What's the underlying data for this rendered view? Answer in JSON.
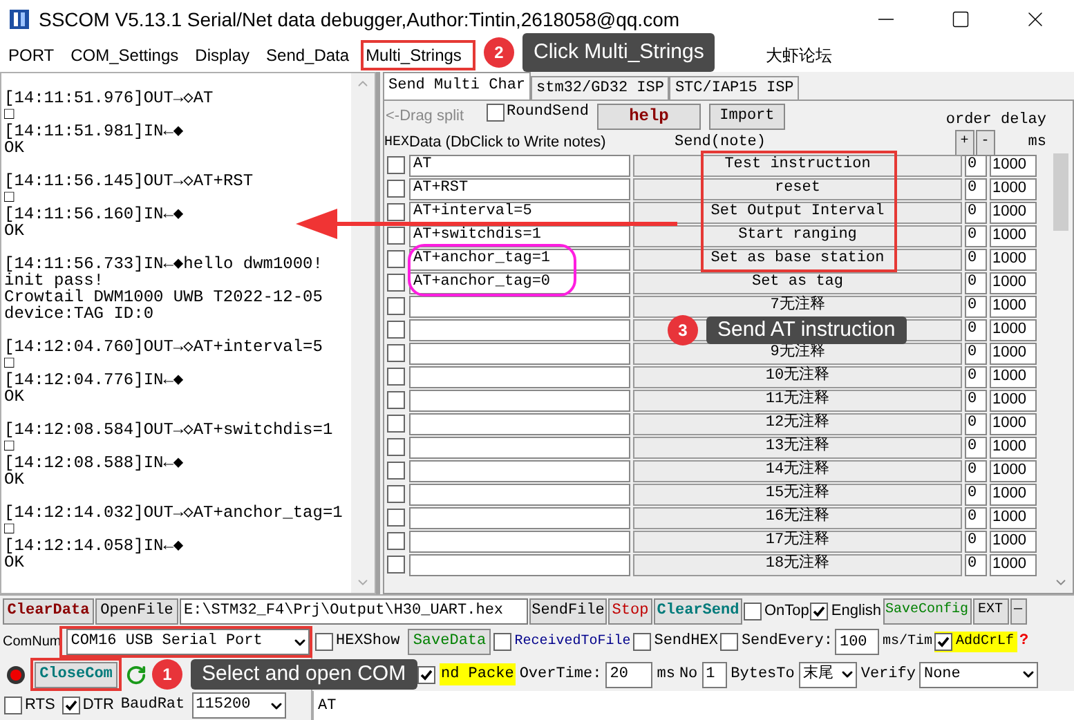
{
  "window": {
    "title": "SSCOM V5.13.1 Serial/Net data debugger,Author:Tintin,2618058@qq.com"
  },
  "menu": [
    {
      "label": "PORT"
    },
    {
      "label": "COM_Settings"
    },
    {
      "label": "Display"
    },
    {
      "label": "Send_Data"
    },
    {
      "label": "Multi_Strings"
    },
    {
      "label": "大虾论坛"
    }
  ],
  "log": [
    {
      "lines": [
        "[14:11:51.976]OUT→◇AT",
        "□",
        "[14:11:51.981]IN←◆",
        "OK"
      ]
    },
    {
      "lines": [
        "[14:11:56.145]OUT→◇AT+RST",
        "□",
        "[14:11:56.160]IN←◆",
        "OK"
      ]
    },
    {
      "lines": [
        "[14:11:56.733]IN←◆hello dwm1000!",
        "init pass!",
        "Crowtail DWM1000 UWB T2022-12-05",
        "device:TAG ID:0"
      ]
    },
    {
      "lines": [
        "[14:12:04.760]OUT→◇AT+interval=5",
        "□",
        "[14:12:04.776]IN←◆",
        "OK"
      ]
    },
    {
      "lines": [
        "[14:12:08.584]OUT→◇AT+switchdis=1",
        "□",
        "[14:12:08.588]IN←◆",
        "OK"
      ]
    },
    {
      "lines": [
        "[14:12:14.032]OUT→◇AT+anchor_tag=1",
        "□",
        "[14:12:14.058]IN←◆",
        "OK"
      ]
    }
  ],
  "tabs": [
    {
      "label": "Send Multi Char",
      "selected": true
    },
    {
      "label": "stm32/GD32 ISP",
      "selected": false
    },
    {
      "label": "STC/IAP15 ISP",
      "selected": false
    }
  ],
  "toolbar": {
    "drag_split": "<-Drag split",
    "round_send": {
      "label": "RoundSend",
      "checked": false
    },
    "help": "help",
    "import": "Import",
    "order_delay": "order delay"
  },
  "table": {
    "hex": "HEX",
    "data": "Data (DbClick to Write notes)",
    "send": "Send(note)",
    "plus": "+",
    "minus": "-",
    "ms": "ms",
    "rows": [
      {
        "hex": false,
        "data": "AT",
        "note": "Test instruction",
        "order": "0",
        "delay": "1000"
      },
      {
        "hex": false,
        "data": "AT+RST",
        "note": "reset",
        "order": "0",
        "delay": "1000"
      },
      {
        "hex": false,
        "data": "AT+interval=5",
        "note": "Set Output Interval",
        "order": "0",
        "delay": "1000"
      },
      {
        "hex": false,
        "data": "AT+switchdis=1",
        "note": "Start ranging",
        "order": "0",
        "delay": "1000"
      },
      {
        "hex": false,
        "data": "AT+anchor_tag=1",
        "note": "Set as base station",
        "order": "0",
        "delay": "1000"
      },
      {
        "hex": false,
        "data": "AT+anchor_tag=0",
        "note": "Set as tag",
        "order": "0",
        "delay": "1000"
      },
      {
        "hex": false,
        "note": "7无注释",
        "order": "0",
        "delay": "1000"
      },
      {
        "hex": false,
        "order": "0",
        "delay": "1000"
      },
      {
        "hex": false,
        "note": "9无注释",
        "order": "0",
        "delay": "1000"
      },
      {
        "hex": false,
        "note": "10无注释",
        "order": "0",
        "delay": "1000"
      },
      {
        "hex": false,
        "note": "11无注释",
        "order": "0",
        "delay": "1000"
      },
      {
        "hex": false,
        "note": "12无注释",
        "order": "0",
        "delay": "1000"
      },
      {
        "hex": false,
        "note": "13无注释",
        "order": "0",
        "delay": "1000"
      },
      {
        "hex": false,
        "note": "14无注释",
        "order": "0",
        "delay": "1000"
      },
      {
        "hex": false,
        "note": "15无注释",
        "order": "0",
        "delay": "1000"
      },
      {
        "hex": false,
        "note": "16无注释",
        "order": "0",
        "delay": "1000"
      },
      {
        "hex": false,
        "note": "17无注释",
        "order": "0",
        "delay": "1000"
      },
      {
        "hex": false,
        "note": "18无注释",
        "order": "0",
        "delay": "1000"
      }
    ]
  },
  "bottom": {
    "clear_data": "ClearData",
    "open_file": "OpenFile",
    "file_path": "E:\\STM32_F4\\Prj\\Output\\H30_UART.hex",
    "send_file": "SendFile",
    "stop": "Stop",
    "clear_send": "ClearSend",
    "on_top": {
      "label": "OnTop",
      "checked": false
    },
    "english": {
      "label": "English",
      "checked": true
    },
    "save_config": "SaveConfig",
    "ext": "EXT",
    "collapse": "—",
    "com_num_label": "ComNum",
    "com_port": "COM16 USB Serial Port",
    "hex_show": {
      "label": "HEXShow",
      "checked": false
    },
    "save_data": "SaveData",
    "received_to_file": {
      "label": "ReceivedToFile",
      "checked": false
    },
    "send_hex": {
      "label": "SendHEX",
      "checked": false
    },
    "send_every": {
      "label": "SendEvery:",
      "checked": false
    },
    "send_every_value": "100",
    "ms_tim": "ms/Tim",
    "add_crlf": {
      "label": "AddCrLf",
      "checked": true
    },
    "help_mark": "?",
    "close_com": "CloseCom",
    "show_time": {
      "label": "nd Packe",
      "checked": true
    },
    "overtime_label": "OverTime:",
    "overtime_value": "20",
    "ms": "ms",
    "no_label": "No",
    "no_value": "1",
    "bytes_to": "BytesTo",
    "bytes_to_value": "末尾",
    "verify_label": "Verify",
    "verify_value": "None",
    "rts": {
      "label": "RTS",
      "checked": false
    },
    "dtr": {
      "label": "DTR",
      "checked": true
    },
    "baud_label": "BaudRat",
    "baud_value": "115200",
    "send_text": "AT"
  },
  "steps": [
    {
      "number": "2",
      "text": "Click Multi_Strings"
    },
    {
      "number": "3",
      "text": "Send AT instruction"
    },
    {
      "number": "1",
      "text": "Select and open COM"
    }
  ]
}
